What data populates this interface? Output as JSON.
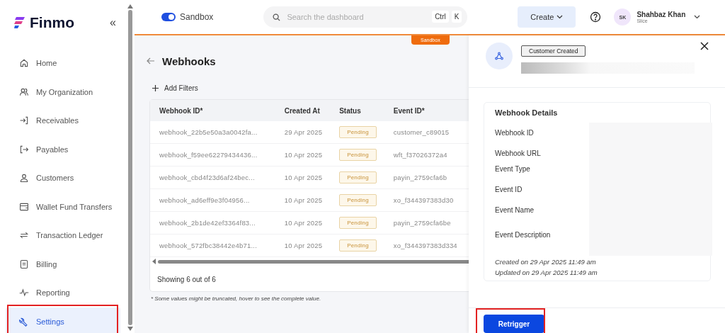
{
  "sidebar": {
    "logo": "Finmo",
    "collapse_icon": "«",
    "items": [
      {
        "label": "Home",
        "selected": false,
        "highlighted": false
      },
      {
        "label": "My Organization",
        "selected": false,
        "highlighted": false
      },
      {
        "label": "Receivables",
        "selected": false,
        "highlighted": false
      },
      {
        "label": "Payables",
        "selected": false,
        "highlighted": false
      },
      {
        "label": "Customers",
        "selected": false,
        "highlighted": false
      },
      {
        "label": "Wallet Fund Transfers",
        "selected": false,
        "highlighted": false
      },
      {
        "label": "Transaction Ledger",
        "selected": false,
        "highlighted": false
      },
      {
        "label": "Billing",
        "selected": false,
        "highlighted": false
      },
      {
        "label": "Reporting",
        "selected": false,
        "highlighted": false
      },
      {
        "label": "Settings",
        "selected": true,
        "highlighted": true
      }
    ]
  },
  "topbar": {
    "sandbox_toggle": {
      "label": "Sandbox",
      "on": true
    },
    "search": {
      "placeholder": "Search the dashboard",
      "keys": [
        "Ctrl",
        "K"
      ]
    },
    "create_button": "Create",
    "user": {
      "initials": "SK",
      "name": "Shahbaz Khan",
      "org": "Slice"
    }
  },
  "environment_tag": "Sandbox",
  "page": {
    "title": "Webhooks",
    "add_filters": "Add Filters",
    "table": {
      "columns": [
        "Webhook ID*",
        "Created At",
        "Status",
        "Event ID*"
      ],
      "rows": [
        {
          "webhook_id": "webhook_22b5e50a3a0042fa...",
          "created_at": "29 Apr 2025",
          "status": "Pending",
          "event_id": "customer_c89015"
        },
        {
          "webhook_id": "webhook_f59ee62279434436...",
          "created_at": "10 Apr 2025",
          "status": "Pending",
          "event_id": "wft_f37026372a4"
        },
        {
          "webhook_id": "webhook_cbd4f23d6af24bec...",
          "created_at": "10 Apr 2025",
          "status": "Pending",
          "event_id": "payin_2759cfa6b"
        },
        {
          "webhook_id": "webhook_ad6eff9e3f04956...",
          "created_at": "10 Apr 2025",
          "status": "Pending",
          "event_id": "xo_f344397383d30"
        },
        {
          "webhook_id": "webhook_2b1de42ef3364f83...",
          "created_at": "10 Apr 2025",
          "status": "Pending",
          "event_id": "payin_2759cfa6be"
        },
        {
          "webhook_id": "webhook_572fbc38442e4b71...",
          "created_at": "10 Apr 2025",
          "status": "Pending",
          "event_id": "xo_f344397383d334"
        }
      ],
      "footer": "Showing 6 out of 6"
    },
    "footnote": "* Some values might be truncated, hover to see the complete value."
  },
  "panel": {
    "event_badge": "Customer Created",
    "details_title": "Webhook Details",
    "fields": [
      "Webhook ID",
      "Webhook URL",
      "Event Type",
      "Event ID",
      "Event Name",
      "Event Description"
    ],
    "created": "Created on 29 Apr 2025 11:49 am",
    "updated": "Updated on 29 Apr 2025 11:49 am",
    "retrigger": {
      "label": "Retrigger",
      "highlighted": true
    }
  }
}
